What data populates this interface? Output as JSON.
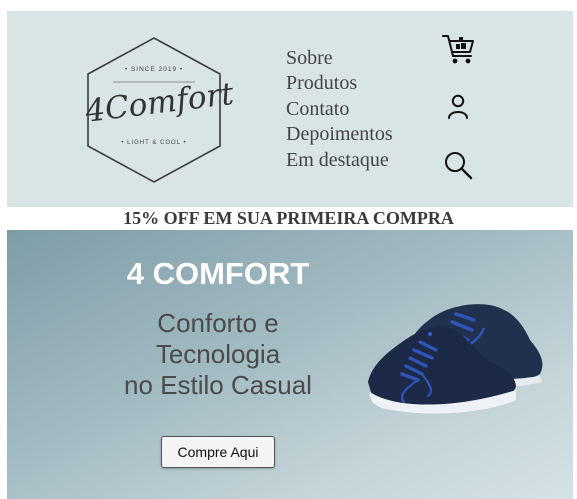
{
  "header": {
    "logo": {
      "since": "• SINCE 2019 •",
      "wordmark": "4Comfort",
      "tagline": "• LIGHT & COOL •"
    },
    "nav": [
      "Sobre",
      "Produtos",
      "Contato",
      "Depoimentos",
      "Em destaque"
    ],
    "icons": [
      "cart-icon",
      "user-icon",
      "search-icon"
    ]
  },
  "promo": "15% OFF EM SUA PRIMEIRA COMPRA",
  "hero": {
    "title": "4 COMFORT",
    "subtitle_lines": [
      "Conforto e",
      "Tecnologia",
      "no Estilo Casual"
    ],
    "cta_label": "Compre Aqui",
    "image": "shoe-image"
  },
  "colors": {
    "header_bg": "#d9e4e7",
    "hero_gradient_start": "#7e9ca7",
    "hero_gradient_end": "#d5e2e5",
    "shoe": "#1f2d4a",
    "laces": "#2c4fb0"
  }
}
